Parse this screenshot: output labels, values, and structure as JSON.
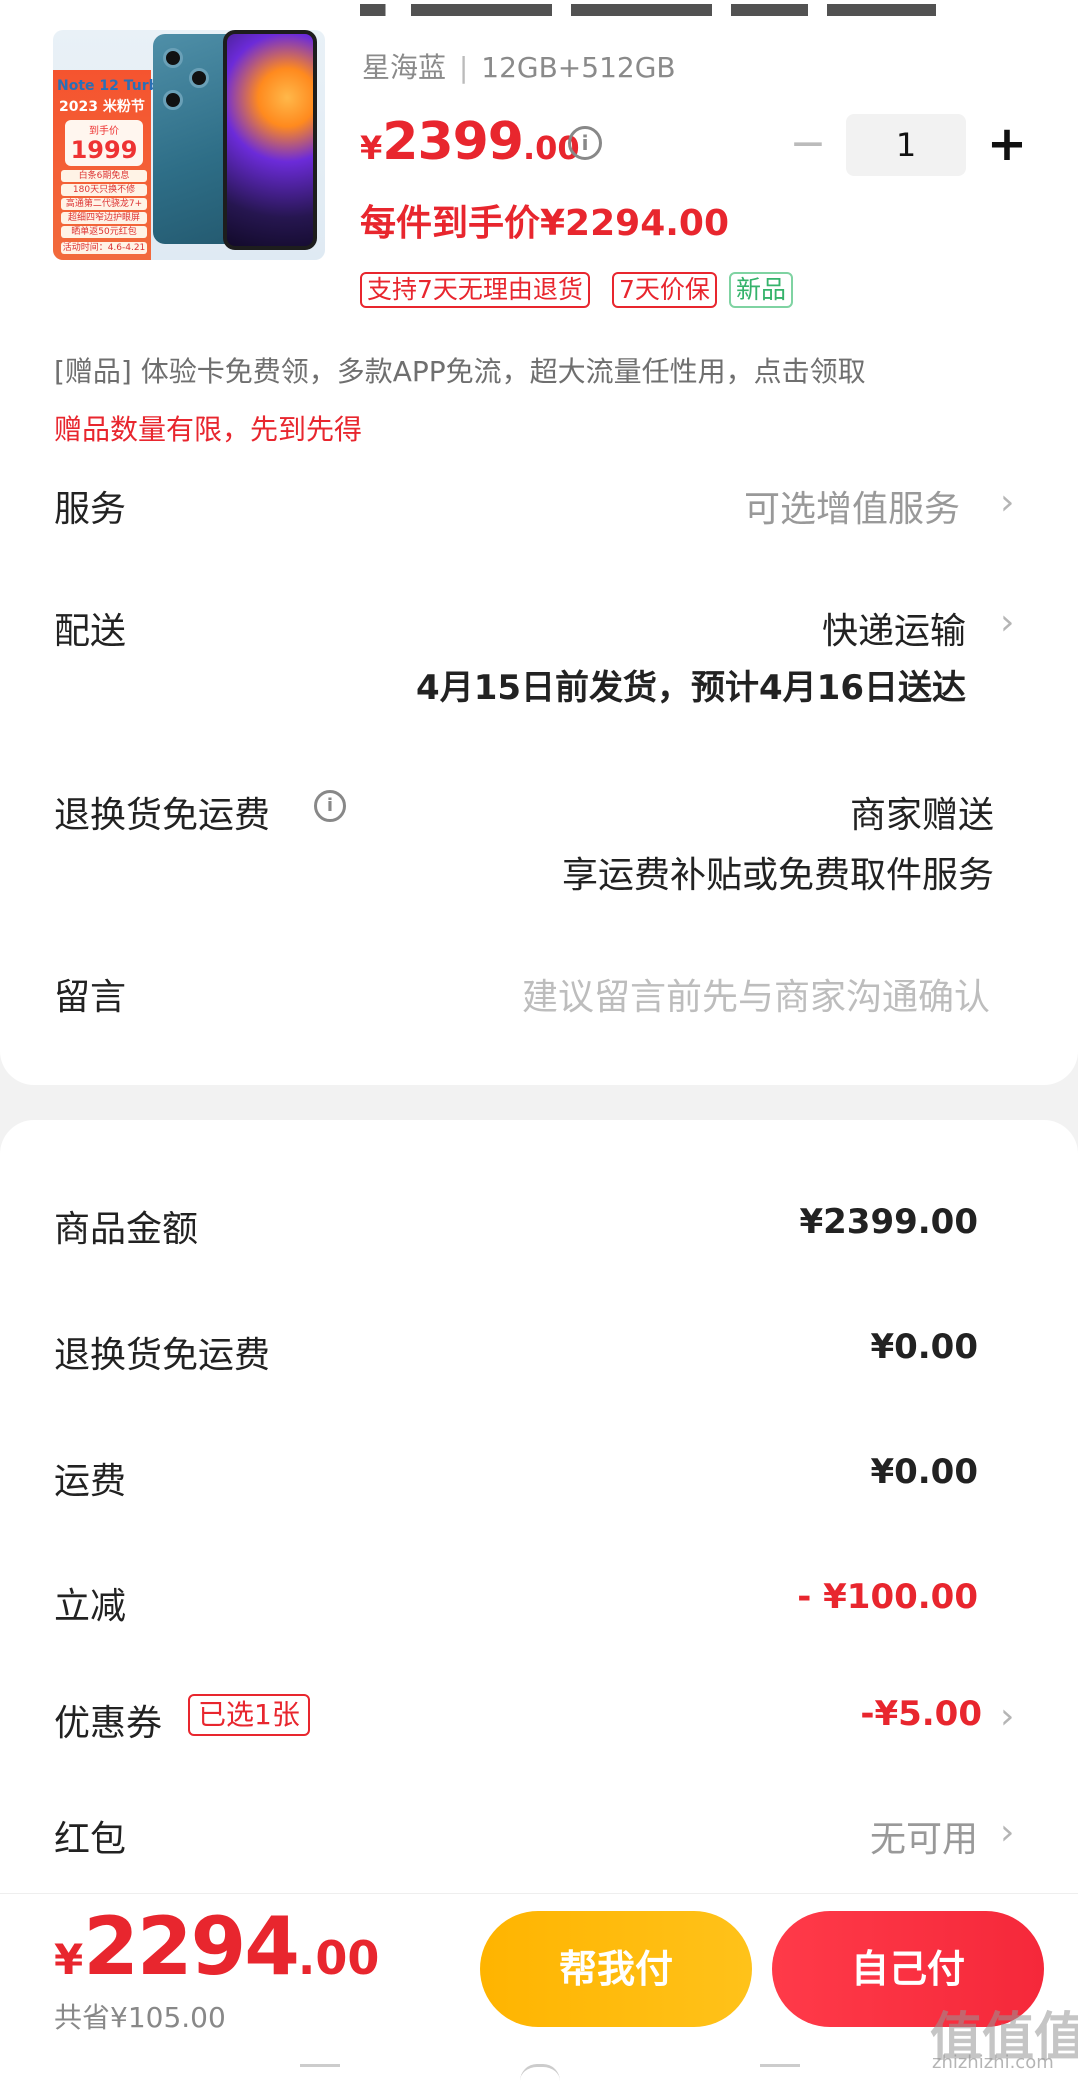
{
  "product": {
    "image_promo": {
      "model": "Note 12 Turbo",
      "festival": "2023 米粉节",
      "price_label": "到手价",
      "price": "1999",
      "lines": [
        "白条6期免息",
        "180天只换不修",
        "高通第二代骁龙7+",
        "超细四窄边护眼屏",
        "晒单返50元红包",
        "活动时间：4.6-4.21"
      ]
    },
    "spec_color": "星海蓝",
    "spec_sep": "|",
    "spec_storage": "12GB+512GB",
    "price_currency": "¥",
    "price_int": "2399",
    "price_dec": ".00",
    "price_each": "每件到手价¥2294.00",
    "quantity": "1",
    "minus_symbol": "−",
    "plus_symbol": "+",
    "tags": [
      "支持7天无理由退货",
      "7天价保",
      "新品"
    ]
  },
  "gift": {
    "line": "[赠品]  体验卡免费领，多款APP免流，超大流量任性用，点击领取",
    "limit": "赠品数量有限，先到先得"
  },
  "rows": {
    "service": {
      "label": "服务",
      "value": "可选增值服务"
    },
    "delivery": {
      "label": "配送",
      "value": "快递运输",
      "detail": "4月15日前发货，预计4月16日送达"
    },
    "return_shipping": {
      "label": "退换货免运费",
      "value": "商家赠送",
      "detail": "享运费补贴或免费取件服务"
    },
    "message": {
      "label": "留言",
      "placeholder": "建议留言前先与商家沟通确认"
    }
  },
  "summary": {
    "goods_amount": {
      "label": "商品金额",
      "value": "¥2399.00"
    },
    "return_fee": {
      "label": "退换货免运费",
      "value": "¥0.00"
    },
    "shipping": {
      "label": "运费",
      "value": "¥0.00"
    },
    "discount": {
      "label": "立减",
      "value": "- ¥100.00"
    },
    "coupon": {
      "label": "优惠券",
      "badge": "已选1张",
      "value": "-¥5.00"
    },
    "red_packet": {
      "label": "红包",
      "value": "无可用"
    }
  },
  "footer": {
    "total_currency": "¥",
    "total_int": "2294",
    "total_dec": ".00",
    "saved": "共省¥105.00",
    "help_pay": "帮我付",
    "self_pay": "自己付"
  },
  "watermark": {
    "logo": "值值值",
    "url": "zhizhizhi.com"
  },
  "icons": {
    "info": "info-circle-icon",
    "chevron": "chevron-right-icon"
  },
  "colors": {
    "accent_red": "#e8262e",
    "help_pay": "#ffb400",
    "self_pay": "#f5283a",
    "tag_green": "#35b36b"
  }
}
